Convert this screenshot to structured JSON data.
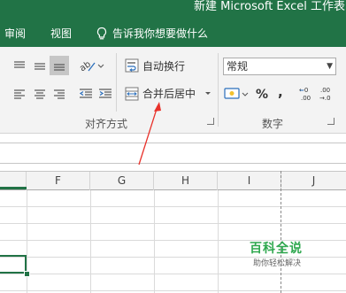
{
  "title_bar": {
    "text": "新建 Microsoft Excel 工作表 -"
  },
  "tabs": [
    {
      "label": "审阅"
    },
    {
      "label": "视图"
    }
  ],
  "tell_me": {
    "text": "告诉我你想要做什么"
  },
  "ribbon": {
    "alignment": {
      "wrap_text_label": "自动换行",
      "merge_center_label": "合并后居中",
      "group_label": "对齐方式"
    },
    "number": {
      "format_value": "常规",
      "percent_symbol": "%",
      "comma_symbol": ",",
      "group_label": "数字"
    }
  },
  "columns": [
    "F",
    "G",
    "H",
    "I",
    "J"
  ],
  "watermark": {
    "title": "百科全说",
    "subtitle": "助你轻松解决"
  },
  "colors": {
    "accent": "#217346",
    "ribbon_bg": "#f3f3f3",
    "annotation": "#e8312a",
    "watermark_green": "#2fa84f"
  },
  "icons": {
    "tell_me": "lightbulb-icon",
    "wrap_text": "wrap-text-icon",
    "merge_center": "merge-center-icon",
    "currency": "currency-icon",
    "increase_decimal": "increase-decimal-icon",
    "decrease_decimal": "decrease-decimal-icon"
  }
}
